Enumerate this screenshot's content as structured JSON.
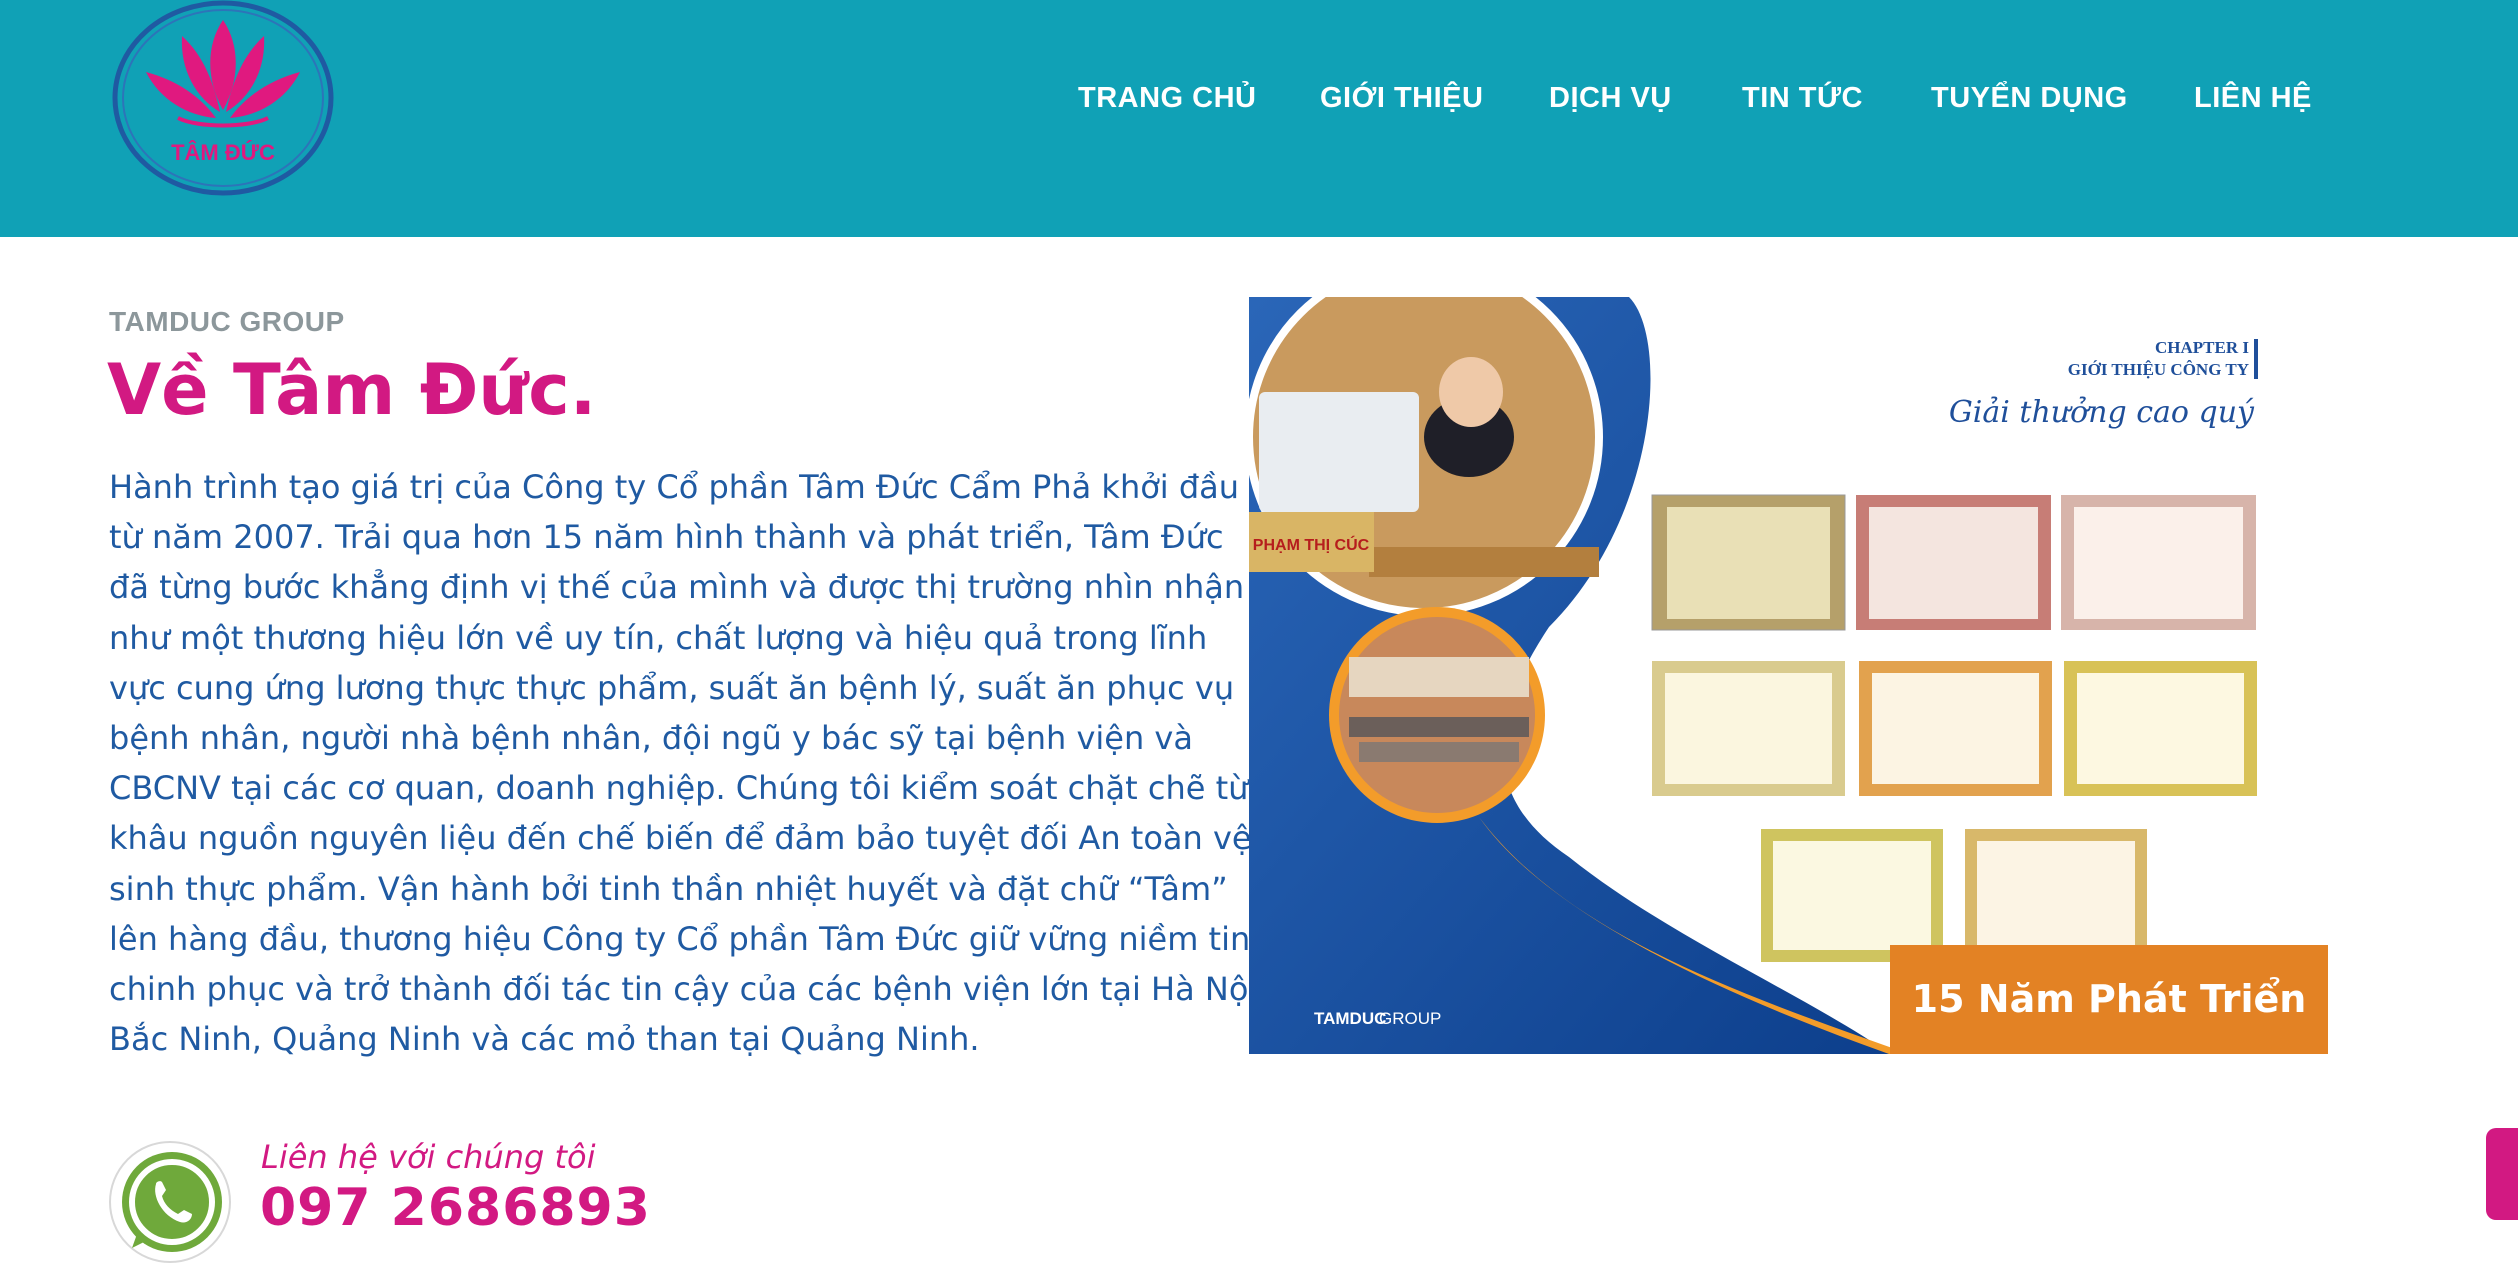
{
  "brand": {
    "name": "TÂM ĐỨC"
  },
  "nav": {
    "items": [
      {
        "label": "TRANG CHỦ"
      },
      {
        "label": "GIỚI THIỆU"
      },
      {
        "label": "DỊCH VỤ"
      },
      {
        "label": "TIN TỨC"
      },
      {
        "label": "TUYỂN DỤNG"
      },
      {
        "label": "LIÊN HỆ"
      }
    ]
  },
  "about": {
    "eyebrow": "TAMDUC GROUP",
    "title": "Về Tâm Đức.",
    "lines": [
      "Hành trình tạo giá trị của Công ty Cổ phần Tâm Đức Cẩm Phả khởi đầu",
      "từ năm 2007. Trải qua hơn 15 năm hình thành và phát triển, Tâm Đức",
      "đã từng bước khẳng định vị thế của mình và được thị trường nhìn nhận",
      "như một thương hiệu lớn về uy tín, chất lượng và hiệu quả trong lĩnh",
      "vực cung ứng lương thực thực phẩm, suất ăn bệnh lý, suất ăn phục vụ",
      "bệnh nhân, người nhà bệnh nhân, đội ngũ y bác sỹ tại bệnh viện và",
      "CBCNV tại các cơ quan, doanh nghiệp. Chúng tôi kiểm soát chặt chẽ từ",
      "khâu nguồn nguyên liệu đến chế biến để đảm bảo tuyệt đối An toàn vệ",
      "sinh thực phẩm. Vận hành bởi tinh thần nhiệt huyết và đặt chữ “Tâm”",
      "lên hàng đầu, thương hiệu Công ty Cổ phần Tâm Đức giữ vững niềm tin,",
      "chinh phục và trở thành đối tác tin cậy của các bệnh viện lớn tại Hà Nội,",
      "Bắc Ninh, Quảng Ninh và các mỏ than tại Quảng Ninh."
    ]
  },
  "photo": {
    "chapter": "CHAPTER I",
    "section": "GIỚI THIỆU CÔNG TY",
    "script": "Giải thưởng cao quý",
    "footer_brand_bold": "TAMDUC",
    "footer_brand_light": " GROUP",
    "name_plate": "PHẠM THỊ CÚC",
    "badge": "15 Năm Phát Triển"
  },
  "contact": {
    "label": "Liên hệ với chúng tôi",
    "phone": "097 2686893"
  },
  "colors": {
    "header": "#10a1b6",
    "accent": "#d21982",
    "body_text": "#1f5aa2",
    "badge": "#e38224"
  }
}
